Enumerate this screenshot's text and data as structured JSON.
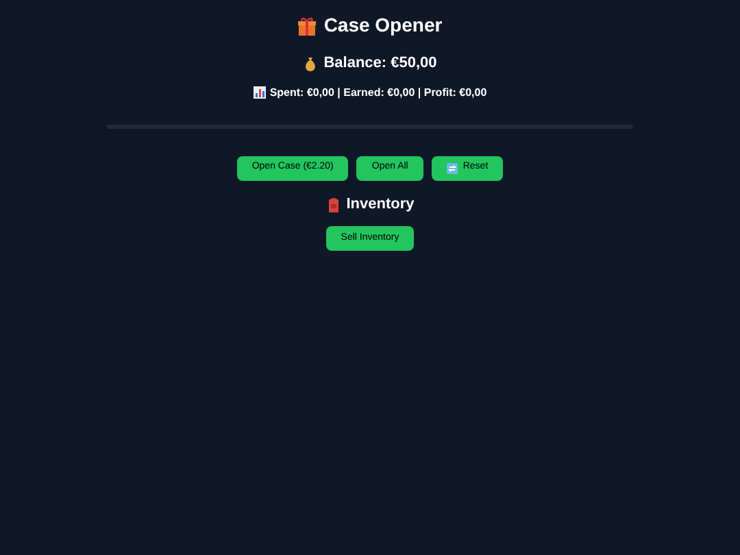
{
  "title": "Case Opener",
  "balance": "Balance: €50,00",
  "stats": "Spent: €0,00 | Earned: €0,00 | Profit: €0,00",
  "buttons": [
    {
      "label": "Open Case (€2.20)",
      "kind": "plain"
    },
    {
      "label": "Open All",
      "kind": "plain"
    },
    {
      "label": "Reset",
      "kind": "reset"
    }
  ],
  "inventory": {
    "heading": "Inventory",
    "button": "Sell Inventory"
  }
}
